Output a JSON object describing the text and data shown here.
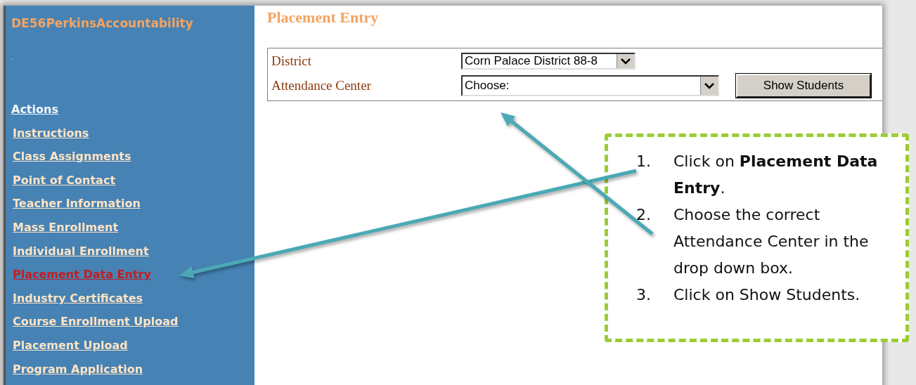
{
  "app": {
    "title": "DE56PerkinsAccountability",
    "subtitle": "."
  },
  "sidebar": {
    "heading": "Actions",
    "items": [
      {
        "label": "Instructions",
        "selected": false
      },
      {
        "label": "Class Assignments",
        "selected": false
      },
      {
        "label": "Point of Contact",
        "selected": false
      },
      {
        "label": "Teacher Information",
        "selected": false
      },
      {
        "label": "Mass Enrollment",
        "selected": false
      },
      {
        "label": "Individual Enrollment",
        "selected": false
      },
      {
        "label": "Placement Data Entry",
        "selected": true
      },
      {
        "label": "Industry Certificates",
        "selected": false
      },
      {
        "label": "Course Enrollment Upload",
        "selected": false
      },
      {
        "label": "Placement Upload",
        "selected": false
      },
      {
        "label": "Program Application",
        "selected": false
      }
    ]
  },
  "page": {
    "title": "Placement Entry",
    "fields": [
      {
        "label": "District",
        "value": "Corn Palace District 88-8"
      },
      {
        "label": "Attendance Center",
        "value": "Choose:"
      }
    ],
    "button": "Show Students"
  },
  "callout": {
    "steps": [
      {
        "number": "1.",
        "text": "Click on **Placement Data Entry**."
      },
      {
        "number": "2.",
        "text": "Choose the correct Attendance Center in the drop down box."
      },
      {
        "number": "3.",
        "text": "Click on Show Students."
      }
    ]
  }
}
